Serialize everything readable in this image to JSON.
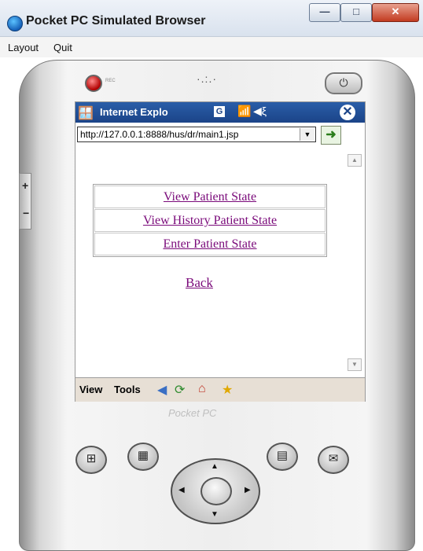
{
  "window": {
    "title": "Pocket PC Simulated Browser",
    "menu": [
      "Layout",
      "Quit"
    ]
  },
  "device": {
    "rec_label": "REC",
    "brand_logo": "Pocket PC"
  },
  "browser": {
    "title": "Internet Explo",
    "address": "http://127.0.0.1:8888/hus/dr/main1.jsp",
    "links": [
      "View Patient State",
      "View History Patient State",
      "Enter Patient State"
    ],
    "back_label": "Back",
    "toolbar": {
      "view": "View",
      "tools": "Tools"
    }
  },
  "colors": {
    "ie_titlebar": "#1b4488",
    "link": "#7a0a7a",
    "toolbar_bg": "#e7dfd5"
  },
  "icons": [
    "windows-flag-icon",
    "signal-icon",
    "volume-icon",
    "close-icon",
    "go-icon",
    "back-arrow-icon",
    "refresh-icon",
    "home-icon",
    "favorites-icon"
  ]
}
